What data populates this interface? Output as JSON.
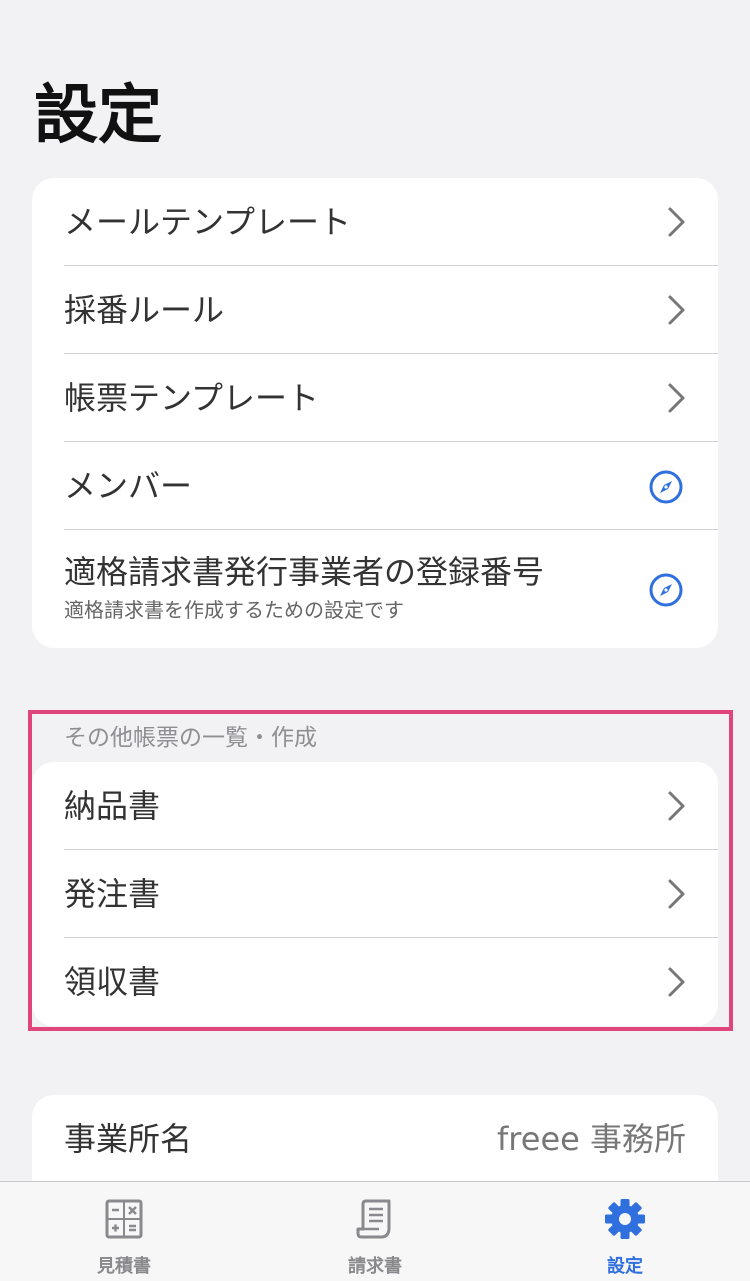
{
  "page": {
    "title": "設定"
  },
  "settings_group": {
    "items": [
      {
        "label": "メールテンプレート",
        "icon": "chevron-right-icon"
      },
      {
        "label": "採番ルール",
        "icon": "chevron-right-icon"
      },
      {
        "label": "帳票テンプレート",
        "icon": "chevron-right-icon"
      },
      {
        "label": "メンバー",
        "icon": "compass-icon"
      },
      {
        "label": "適格請求書発行事業者の登録番号",
        "sublabel": "適格請求書を作成するための設定です",
        "icon": "compass-icon"
      }
    ]
  },
  "other_docs": {
    "header": "その他帳票の一覧・作成",
    "items": [
      {
        "label": "納品書",
        "icon": "chevron-right-icon"
      },
      {
        "label": "発注書",
        "icon": "chevron-right-icon"
      },
      {
        "label": "領収書",
        "icon": "chevron-right-icon"
      }
    ]
  },
  "office": {
    "label": "事業所名",
    "value": "freee 事務所"
  },
  "tabbar": {
    "tabs": [
      {
        "label": "見積書",
        "icon": "calculator-icon",
        "active": false
      },
      {
        "label": "請求書",
        "icon": "receipt-icon",
        "active": false
      },
      {
        "label": "設定",
        "icon": "gear-icon",
        "active": true
      }
    ]
  },
  "colors": {
    "accent": "#2f6fde",
    "highlight": "#e0457b",
    "background": "#f2f2f5"
  }
}
